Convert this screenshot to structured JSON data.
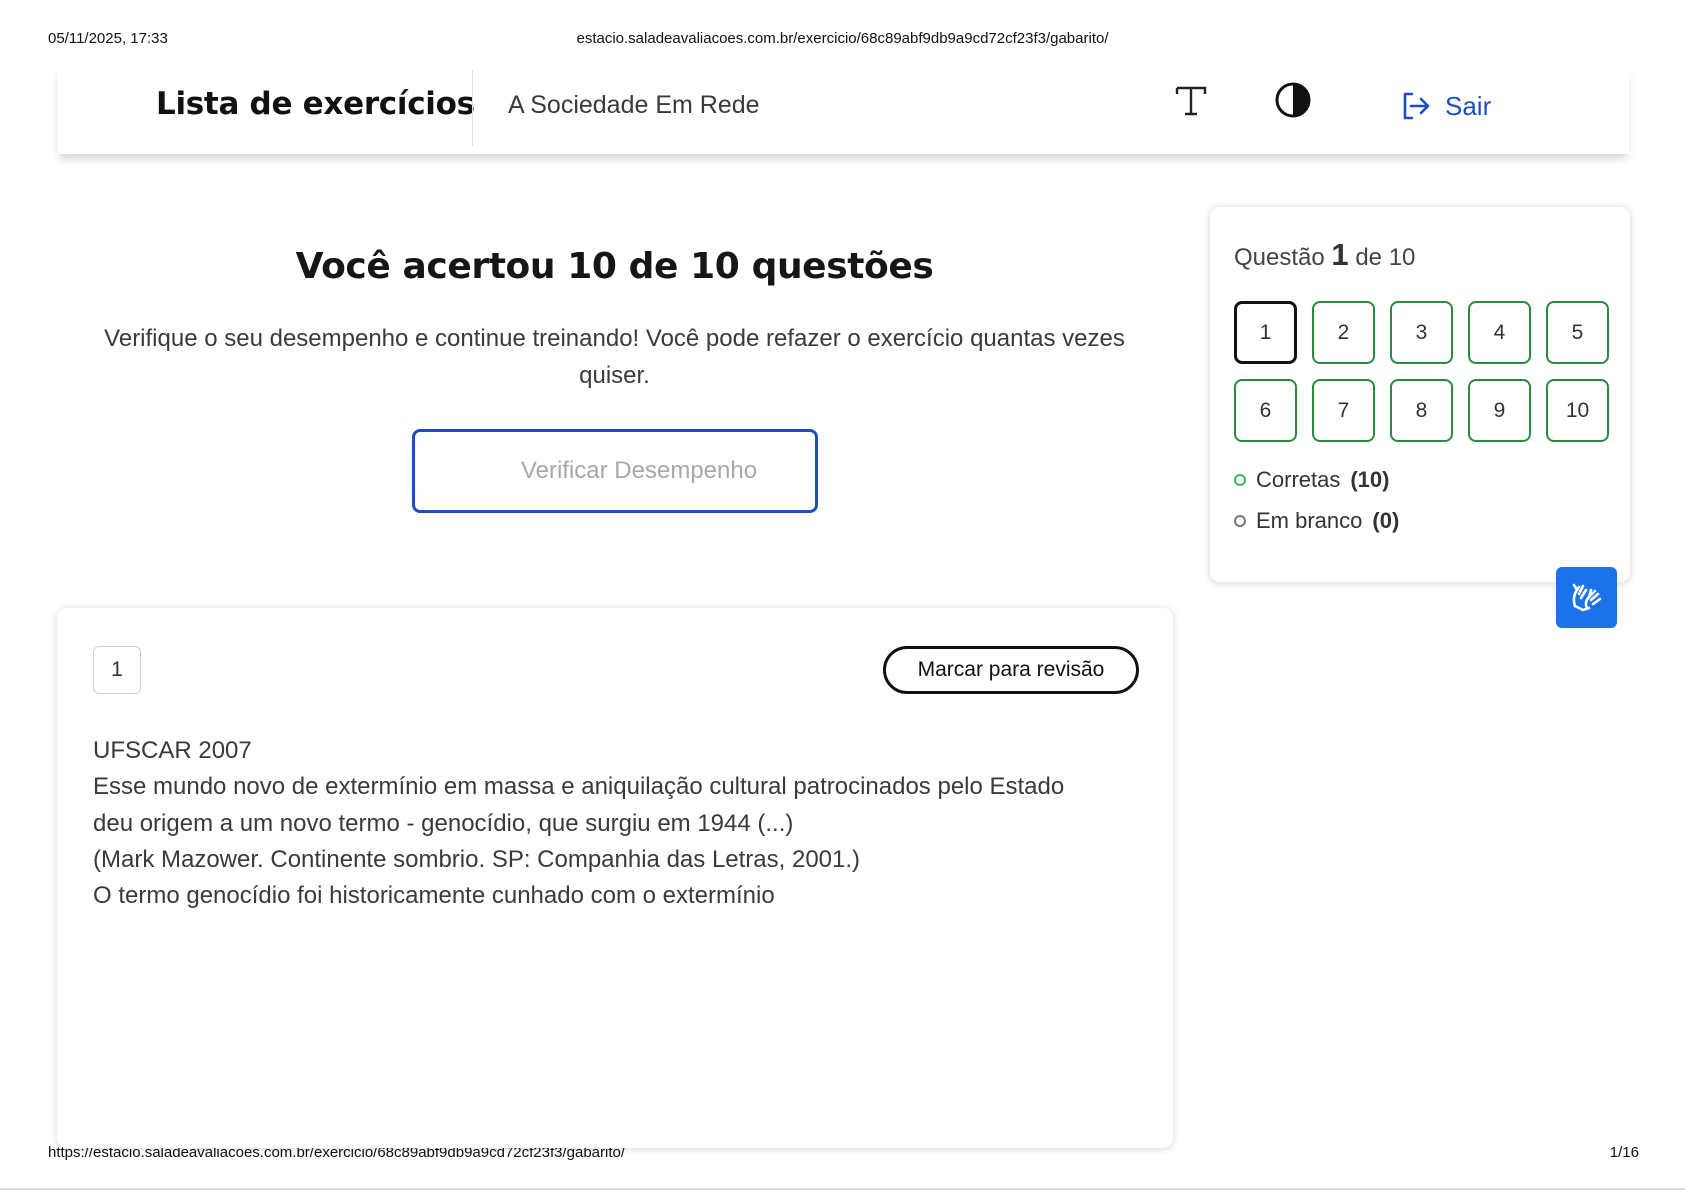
{
  "print": {
    "date": "05/11/2025, 17:33",
    "header_url": "estacio.saladeavaliacoes.com.br/exercicio/68c89abf9db9a9cd72cf23f3/gabarito/",
    "footer_url": "https://estacio.saladeavaliacoes.com.br/exercicio/68c89abf9db9a9cd72cf23f3/gabarito/",
    "page": "1/16"
  },
  "header": {
    "brand": "Lista de exercícios",
    "subject": "A Sociedade Em Rede",
    "font_icon": "text-size-icon",
    "contrast_icon": "contrast-icon",
    "logout_label": "Sair",
    "logout_icon": "logout-icon",
    "accent_color": "#1a4fc4"
  },
  "result": {
    "title": "Você acertou 10 de 10 questões",
    "text": "Verifique o seu desempenho e continue treinando! Você pode refazer o exercício quantas vezes quiser.",
    "verify_button": "Verificar Desempenho"
  },
  "panel": {
    "counter_prefix": "Questão",
    "counter_current": "1",
    "counter_suffix": "de 10",
    "questions": [
      "1",
      "2",
      "3",
      "4",
      "5",
      "6",
      "7",
      "8",
      "9",
      "10"
    ],
    "correct_label": "Corretas",
    "correct_count": "(10)",
    "blank_label": "Em branco",
    "blank_count": "(0)",
    "correct_color": "#2a8a3e"
  },
  "libras_icon": "sign-language-hands-icon",
  "question": {
    "number": "1",
    "review_button": "Marcar para revisão",
    "lines": [
      "UFSCAR 2007",
      "Esse mundo novo de extermínio em massa e aniquilação cultural patrocinados pelo Estado",
      "deu origem a um novo termo - genocídio, que surgiu em 1944 (...)",
      "(Mark Mazower. Continente sombrio. SP: Companhia das Letras, 2001.)",
      "O termo genocídio foi historicamente cunhado com o extermínio"
    ]
  }
}
